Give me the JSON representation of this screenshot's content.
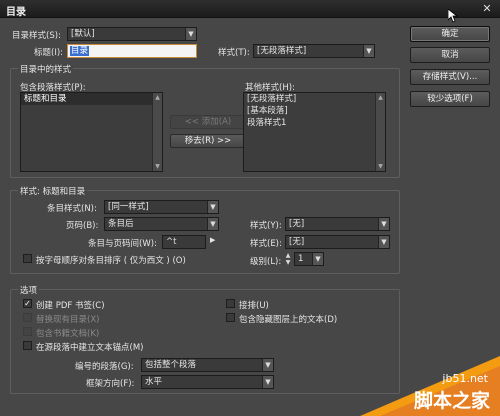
{
  "window": {
    "title": "目录"
  },
  "buttons": {
    "ok": "确定",
    "cancel": "取消",
    "save_style": "存储样式(V)...",
    "fewer_options": "较少选项(F)"
  },
  "toc_style": {
    "label": "目录样式(S):",
    "value": "[默认]"
  },
  "title_field": {
    "label": "标题(I):",
    "value": "目录"
  },
  "title_style": {
    "label": "样式(T):",
    "value": "[无段落样式]"
  },
  "styles_group": {
    "legend": "目录中的样式",
    "include_label": "包含段落样式(P):",
    "include_items": [
      "标题和目录"
    ],
    "other_label": "其他样式(H):",
    "other_items": [
      "[无段落样式]",
      "[基本段落]",
      "段落样式1"
    ],
    "add_button": "<< 添加(A)",
    "remove_button": "移去(R) >>"
  },
  "style_group": {
    "legend": "样式: 标题和目录",
    "entry_style_label": "条目样式(N):",
    "entry_style_value": "[同一样式]",
    "page_number_label": "页码(B):",
    "page_number_value": "条目后",
    "page_number_style_label": "样式(Y):",
    "page_number_style_value": "[无]",
    "separator_label": "条目与页码间(W):",
    "separator_value": "^t",
    "separator_style_label": "样式(E):",
    "separator_style_value": "[无]",
    "sort_label": "按字母顺序对条目排序 ( 仅为西文 ) (O)",
    "level_label": "级别(L):",
    "level_value": "1"
  },
  "options_group": {
    "legend": "选项",
    "create_pdf": "创建 PDF 书签(C)",
    "replace_toc": "替换现有目录(X)",
    "include_book": "包含书籍文档(K)",
    "anchor_source": "在源段落中建立文本锚点(M)",
    "run_in": "接排(U)",
    "hidden_layers": "包含隐藏图层上的文本(D)",
    "numbered_label": "编号的段落(G):",
    "numbered_value": "包括整个段落",
    "frame_label": "框架方向(F):",
    "frame_value": "水平"
  },
  "watermark": {
    "site": "jb51.net",
    "brand": "脚本之家"
  },
  "colors": {
    "accent_selection": "#3a6fd0",
    "watermark_orange": "#f39c12"
  }
}
